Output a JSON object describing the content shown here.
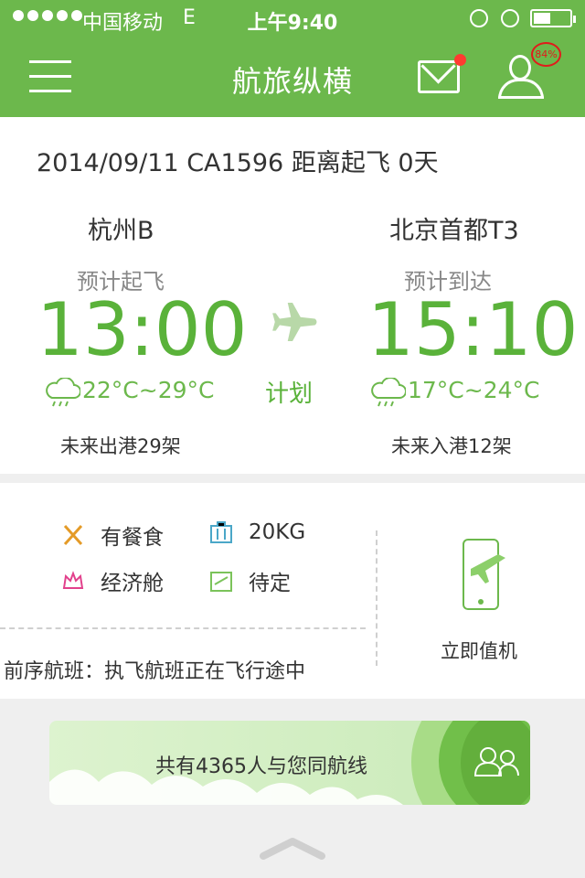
{
  "status_bar": {
    "carrier": "中国移动",
    "network": "E",
    "time": "上午9:40"
  },
  "nav": {
    "title": "航旅纵横",
    "user_badge": "84%"
  },
  "flight": {
    "summary": "2014/09/11 CA1596  距离起飞  0天",
    "departure": {
      "city": "杭州B",
      "label": "预计起飞",
      "time": "13:00",
      "weather": "22°C~29°C",
      "traffic": "未来出港29架"
    },
    "arrival": {
      "city": "北京首都T3",
      "label": "预计到达",
      "time": "15:10",
      "weather": "17°C~24°C",
      "traffic": "未来入港12架"
    },
    "status": "计划"
  },
  "info": {
    "meal": "有餐食",
    "baggage": "20KG",
    "cabin": "经济舱",
    "checkin_status": "待定",
    "previous_flight": "前序航班：执飞航班正在飞行途中",
    "checkin_button": "立即值机"
  },
  "banner": {
    "text": "共有4365人与您同航线"
  },
  "colors": {
    "brand_green": "#6cb84c",
    "time_green": "#5ab23a",
    "notification_red": "#ff3b30"
  }
}
